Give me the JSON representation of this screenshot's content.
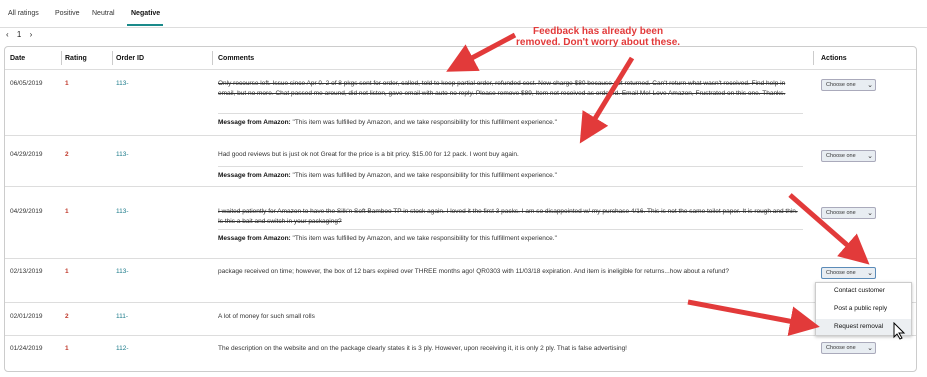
{
  "tabs": [
    {
      "label": "All ratings"
    },
    {
      "label": "Positive"
    },
    {
      "label": "Neutral"
    },
    {
      "label": "Negative"
    }
  ],
  "pager": {
    "prev": "‹",
    "page": "1",
    "next": "›"
  },
  "table": {
    "headers": {
      "date": "Date",
      "rating": "Rating",
      "order_id": "Order ID",
      "comments": "Comments",
      "actions": "Actions"
    },
    "rows": [
      {
        "date": "06/05/2019",
        "rating": "1",
        "order": "113-",
        "comment": "Only recourse left. Issue since Apr 0. 2 of 8 pkgs sent for order, called, told to keep partial order, refunded cost. New charge $80 because not returned. Can't return what wasn't received. Find help in email, but no more. Chat passed me around, did not listen, gave email with auto no reply. Please remove $89, Item not received as ordered. Email Me! Love Amazon, Frustrated on this one. Thanks.",
        "message_label": "Message from Amazon:",
        "message": "\"This item was fulfilled by Amazon, and we take responsibility for this fulfillment experience.\"",
        "action": "Choose one"
      },
      {
        "date": "04/29/2019",
        "rating": "2",
        "order": "113-",
        "comment": "Had good reviews but is just ok not Great for the price is a bit pricy. $15.00 for 12 pack. I wont buy again.",
        "message_label": "Message from Amazon:",
        "message": "\"This item was fulfilled by Amazon, and we take responsibility for this fulfillment experience.\"",
        "action": "Choose one"
      },
      {
        "date": "04/29/2019",
        "rating": "1",
        "order": "113-",
        "comment": "I waited patiently for Amazon to have the Silk'n Soft Bamboo TP in stock again. I loved it the first 3 packs. I am so disappointed w/ my purchase 4/16. This is not the same toilet paper. It is rough and thin. Is this a bait and switch in your packaging?",
        "message_label": "Message from Amazon:",
        "message": "\"This item was fulfilled by Amazon, and we take responsibility for this fulfillment experience.\"",
        "action": "Choose one"
      },
      {
        "date": "02/13/2019",
        "rating": "1",
        "order": "113-",
        "comment": "package received on time; however, the box of 12 bars expired over THREE months ago! QR0303 with 11/03/18 expiration. And item is ineligible for returns...how about a refund?",
        "action": "Choose one"
      },
      {
        "date": "02/01/2019",
        "rating": "2",
        "order": "111-",
        "comment": "A lot of money for such small rolls"
      },
      {
        "date": "01/24/2019",
        "rating": "1",
        "order": "112-",
        "comment": "The description on the website and on the package clearly states it is 3 ply. However, upon receiving it, it is only 2 ply. That is false advertising!",
        "action": "Choose one"
      }
    ]
  },
  "dropdown": {
    "items": [
      "Contact customer",
      "Post a public reply",
      "Request removal"
    ]
  },
  "annotation": {
    "line1": "Feedback has already been",
    "line2": "removed. Don't worry about these."
  },
  "colors": {
    "accent": "#1a8a8a",
    "annotation": "#e23a3a",
    "rating": "#c0392b"
  }
}
